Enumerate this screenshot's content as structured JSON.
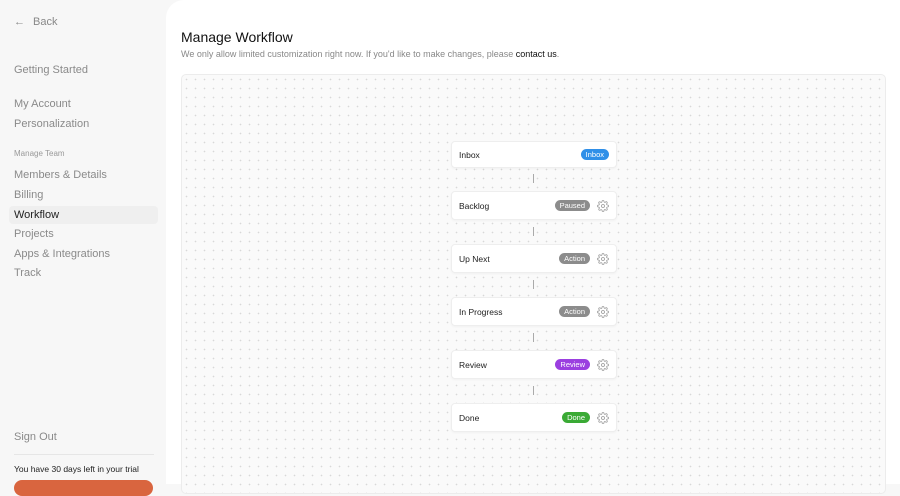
{
  "sidebar": {
    "back": "Back",
    "getting_started": "Getting Started",
    "my_account": "My Account",
    "personalization": "Personalization",
    "section": "Manage Team",
    "members": "Members & Details",
    "billing": "Billing",
    "workflow": "Workflow",
    "projects": "Projects",
    "apps": "Apps & Integrations",
    "track": "Track",
    "sign_out": "Sign Out",
    "trial": "You have 30 days left in your trial"
  },
  "main": {
    "title": "Manage Workflow",
    "subtitle": "We only allow limited customization right now. If you'd like to make changes, please ",
    "contact": "contact us",
    "period": "."
  },
  "workflow": [
    {
      "name": "Inbox",
      "badge": "Inbox",
      "color": "#2f8fe8",
      "gear": false
    },
    {
      "name": "Backlog",
      "badge": "Paused",
      "color": "#8c8c8c",
      "gear": true
    },
    {
      "name": "Up Next",
      "badge": "Action",
      "color": "#8c8c8c",
      "gear": true
    },
    {
      "name": "In Progress",
      "badge": "Action",
      "color": "#8c8c8c",
      "gear": true
    },
    {
      "name": "Review",
      "badge": "Review",
      "color": "#9b3fe0",
      "gear": true
    },
    {
      "name": "Done",
      "badge": "Done",
      "color": "#3aaa35",
      "gear": true
    }
  ]
}
